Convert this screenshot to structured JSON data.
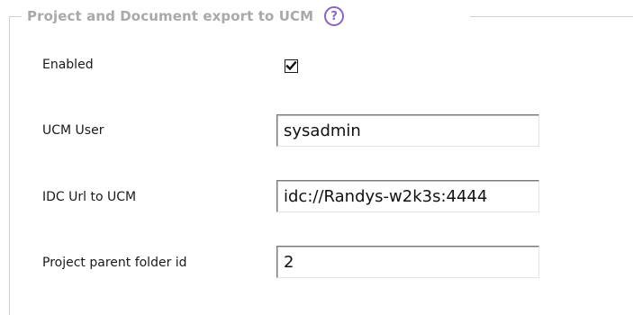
{
  "section": {
    "legend": "Project and Document export to UCM",
    "help_icon": "help-question-icon"
  },
  "fields": {
    "enabled": {
      "label": "Enabled",
      "checked": true
    },
    "ucm_user": {
      "label": "UCM User",
      "value": "sysadmin"
    },
    "idc_url": {
      "label": "IDC Url to UCM",
      "value": "idc://Randys-w2k3s:4444"
    },
    "parent_folder": {
      "label": "Project parent folder id",
      "value": "2"
    }
  },
  "colors": {
    "legend_text": "#a9a9a9",
    "help_icon": "#8a63c4",
    "label_text": "#1a1a1a",
    "frame": "#cfcfcf"
  }
}
